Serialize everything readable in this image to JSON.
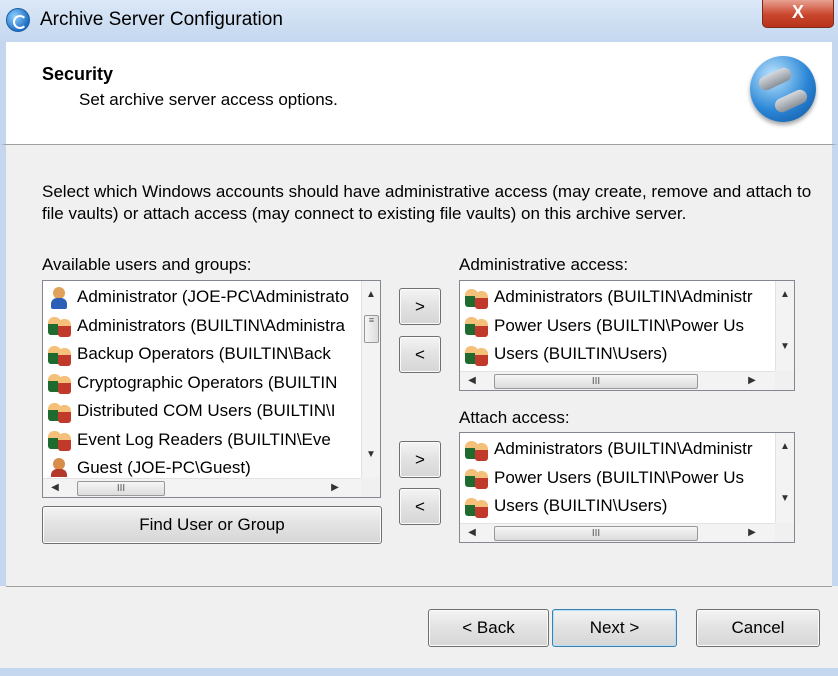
{
  "window": {
    "title": "Archive Server Configuration",
    "close_label": "X"
  },
  "header": {
    "title": "Security",
    "subtitle": "Set archive server access options."
  },
  "description": "Select which Windows accounts should have administrative access (may create, remove and attach to file vaults) or attach access (may connect to existing file vaults) on this archive server.",
  "available": {
    "label": "Available users and groups:",
    "items": [
      {
        "icon": "user-icon",
        "text": "Administrator (JOE-PC\\Administrato"
      },
      {
        "icon": "group-icon",
        "text": "Administrators (BUILTIN\\Administra"
      },
      {
        "icon": "group-icon",
        "text": "Backup Operators (BUILTIN\\Back"
      },
      {
        "icon": "group-icon",
        "text": "Cryptographic Operators (BUILTIN"
      },
      {
        "icon": "group-icon",
        "text": "Distributed COM Users (BUILTIN\\I"
      },
      {
        "icon": "group-icon",
        "text": "Event Log Readers (BUILTIN\\Eve"
      },
      {
        "icon": "guest-icon",
        "text": "Guest (JOE-PC\\Guest)"
      }
    ],
    "find_button": "Find User or Group"
  },
  "admin": {
    "label": "Administrative access:",
    "items": [
      {
        "icon": "group-icon",
        "text": "Administrators (BUILTIN\\Administr"
      },
      {
        "icon": "group-icon",
        "text": "Power Users (BUILTIN\\Power Us"
      },
      {
        "icon": "group-icon",
        "text": "Users (BUILTIN\\Users)"
      }
    ],
    "add_label": ">",
    "remove_label": "<"
  },
  "attach": {
    "label": "Attach access:",
    "items": [
      {
        "icon": "group-icon",
        "text": "Administrators (BUILTIN\\Administr"
      },
      {
        "icon": "group-icon",
        "text": "Power Users (BUILTIN\\Power Us"
      },
      {
        "icon": "group-icon",
        "text": "Users (BUILTIN\\Users)"
      }
    ],
    "add_label": ">",
    "remove_label": "<"
  },
  "scroll": {
    "up": "▲",
    "down": "▼",
    "left": "◀",
    "right": "▶",
    "grip_h": "III",
    "grip_v": "≡"
  },
  "footer": {
    "back": "< Back",
    "next": "Next >",
    "cancel": "Cancel"
  }
}
